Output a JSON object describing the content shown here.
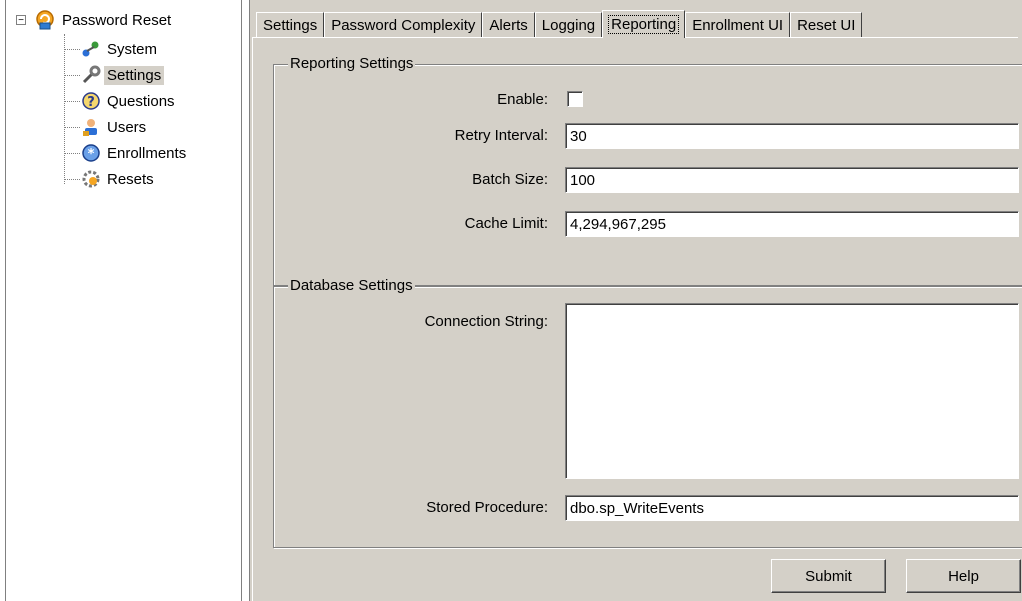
{
  "tree": {
    "root": {
      "label": "Password Reset",
      "icon": "password-reset-icon",
      "toggle": "−"
    },
    "items": [
      {
        "label": "System",
        "icon": "system-icon",
        "selected": false
      },
      {
        "label": "Settings",
        "icon": "wrench-icon",
        "selected": true
      },
      {
        "label": "Questions",
        "icon": "question-icon",
        "selected": false
      },
      {
        "label": "Users",
        "icon": "users-icon",
        "selected": false
      },
      {
        "label": "Enrollments",
        "icon": "enrollments-icon",
        "selected": false
      },
      {
        "label": "Resets",
        "icon": "resets-icon",
        "selected": false
      }
    ]
  },
  "tabs": [
    "Settings",
    "Password Complexity",
    "Alerts",
    "Logging",
    "Reporting",
    "Enrollment UI",
    "Reset UI"
  ],
  "active_tab": "Reporting",
  "reporting": {
    "title": "Reporting Settings",
    "enable_label": "Enable:",
    "enable_checked": false,
    "retry_label": "Retry Interval:",
    "retry_value": "30",
    "batch_label": "Batch Size:",
    "batch_value": "100",
    "cache_label": "Cache Limit:",
    "cache_value": "4,294,967,295"
  },
  "database": {
    "title": "Database Settings",
    "conn_label": "Connection String:",
    "conn_value": "",
    "proc_label": "Stored Procedure:",
    "proc_value": "dbo.sp_WriteEvents"
  },
  "buttons": {
    "submit": "Submit",
    "help": "Help"
  },
  "colors": {
    "face": "#d4d0c8",
    "shadow": "#808080",
    "highlight": "#ffffff"
  }
}
